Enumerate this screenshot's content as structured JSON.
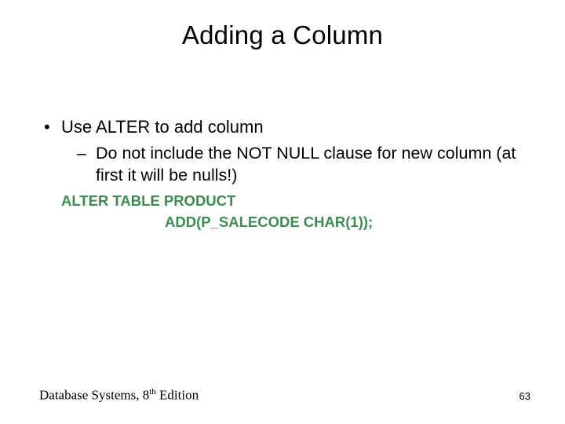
{
  "title": "Adding a Column",
  "bullets": {
    "b1": "Use ALTER to add column",
    "b2": "Do not include the NOT NULL clause for new column (at first it will be nulls!)"
  },
  "code": {
    "line1": "ALTER TABLE PRODUCT",
    "line2": "ADD(P_SALECODE CHAR(1));"
  },
  "footer": {
    "left_prefix": "Database Systems, 8",
    "left_ord": "th",
    "left_suffix": " Edition",
    "page": "63"
  }
}
